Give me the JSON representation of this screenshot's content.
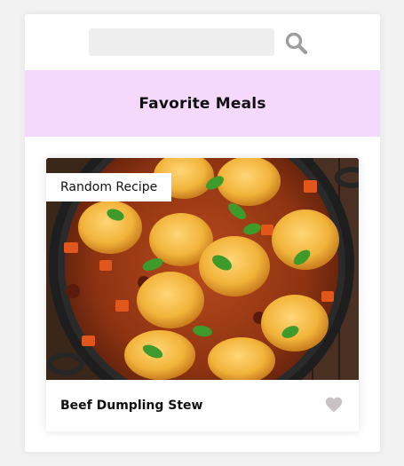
{
  "search": {
    "placeholder": "",
    "value": "",
    "icon": "search-icon",
    "icon_color": "#9e9e9e"
  },
  "favorites": {
    "title": "Favorite Meals",
    "background": "#f5d9fc"
  },
  "meal": {
    "tag": "Random Recipe",
    "name": "Beef Dumpling Stew",
    "image_icon": "stew-photo",
    "favorite_icon": "heart-icon",
    "favorite_color": "#c9c2c4"
  }
}
